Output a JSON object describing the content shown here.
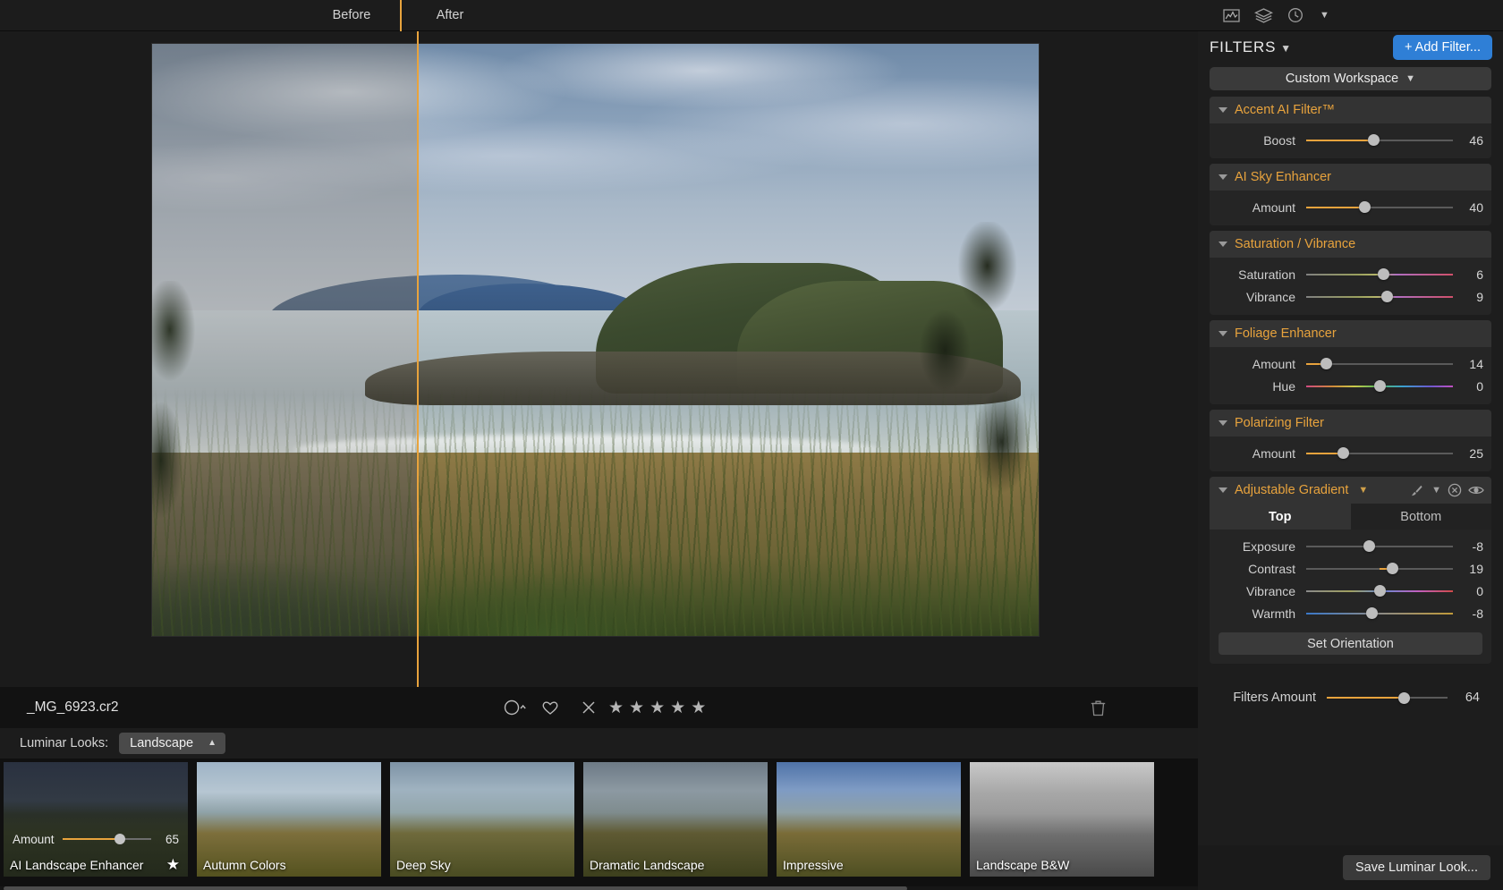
{
  "viewer": {
    "before_label": "Before",
    "after_label": "After",
    "filename": "_MG_6923.cr2",
    "rating": {
      "color_label_icon": "circle-chevron-icon",
      "favorite_icon": "heart-icon",
      "reject_icon": "x-icon",
      "stars": 5,
      "stars_filled": 0,
      "delete_icon": "trash-icon"
    }
  },
  "looks": {
    "label": "Luminar Looks:",
    "category": "Landscape",
    "items": [
      {
        "name": "AI Landscape Enhancer",
        "selected": true,
        "favorite": true,
        "amount_label": "Amount",
        "amount_value": 65,
        "amount_pct": 65
      },
      {
        "name": "Autumn Colors",
        "selected": false,
        "favorite": false
      },
      {
        "name": "Deep Sky",
        "selected": false,
        "favorite": false
      },
      {
        "name": "Dramatic Landscape",
        "selected": false,
        "favorite": false
      },
      {
        "name": "Impressive",
        "selected": false,
        "favorite": false
      },
      {
        "name": "Landscape B&W",
        "selected": false,
        "favorite": false
      }
    ]
  },
  "right_panel": {
    "toolbar_icons": [
      "histogram-icon",
      "layers-icon",
      "history-clock-icon"
    ],
    "title": "FILTERS",
    "add_filter_label": "+ Add Filter...",
    "workspace_label": "Custom Workspace",
    "filters": [
      {
        "name": "Accent AI Filter™",
        "sliders": [
          {
            "label": "Boost",
            "value": 46,
            "pct": 46,
            "style": "amber"
          }
        ]
      },
      {
        "name": "AI Sky Enhancer",
        "sliders": [
          {
            "label": "Amount",
            "value": 40,
            "pct": 40,
            "style": "amber"
          }
        ]
      },
      {
        "name": "Saturation / Vibrance",
        "sliders": [
          {
            "label": "Saturation",
            "value": 6,
            "pct": 53,
            "style": "grad-sat"
          },
          {
            "label": "Vibrance",
            "value": 9,
            "pct": 55,
            "style": "grad-sat"
          }
        ]
      },
      {
        "name": "Foliage Enhancer",
        "sliders": [
          {
            "label": "Amount",
            "value": 14,
            "pct": 14,
            "style": "amber"
          },
          {
            "label": "Hue",
            "value": 0,
            "pct": 50,
            "style": "grad-hue"
          }
        ]
      },
      {
        "name": "Polarizing Filter",
        "sliders": [
          {
            "label": "Amount",
            "value": 25,
            "pct": 25,
            "style": "amber"
          }
        ]
      }
    ],
    "adjustable_gradient": {
      "name": "Adjustable Gradient",
      "icons": [
        "brush-icon",
        "chevron-down-icon",
        "mask-clear-icon",
        "eye-icon"
      ],
      "tabs": [
        {
          "label": "Top",
          "active": true
        },
        {
          "label": "Bottom",
          "active": false
        }
      ],
      "sliders": [
        {
          "label": "Exposure",
          "value": -8,
          "pct": 43,
          "style": "plain"
        },
        {
          "label": "Contrast",
          "value": 19,
          "pct": 59,
          "style": "amber-mid"
        },
        {
          "label": "Vibrance",
          "value": 0,
          "pct": 50,
          "style": "grad-vib"
        },
        {
          "label": "Warmth",
          "value": -8,
          "pct": 45,
          "style": "grad-warm"
        }
      ],
      "set_orientation_label": "Set Orientation"
    },
    "filters_amount": {
      "label": "Filters Amount",
      "value": 64,
      "pct": 64
    },
    "save_look_label": "Save Luminar Look..."
  },
  "colors": {
    "accent_amber": "#e8a33d",
    "add_filter_blue": "#2f7fd6",
    "panel_bg": "#1d1d1d",
    "group_bg": "#252525",
    "header_bg": "#333333"
  }
}
